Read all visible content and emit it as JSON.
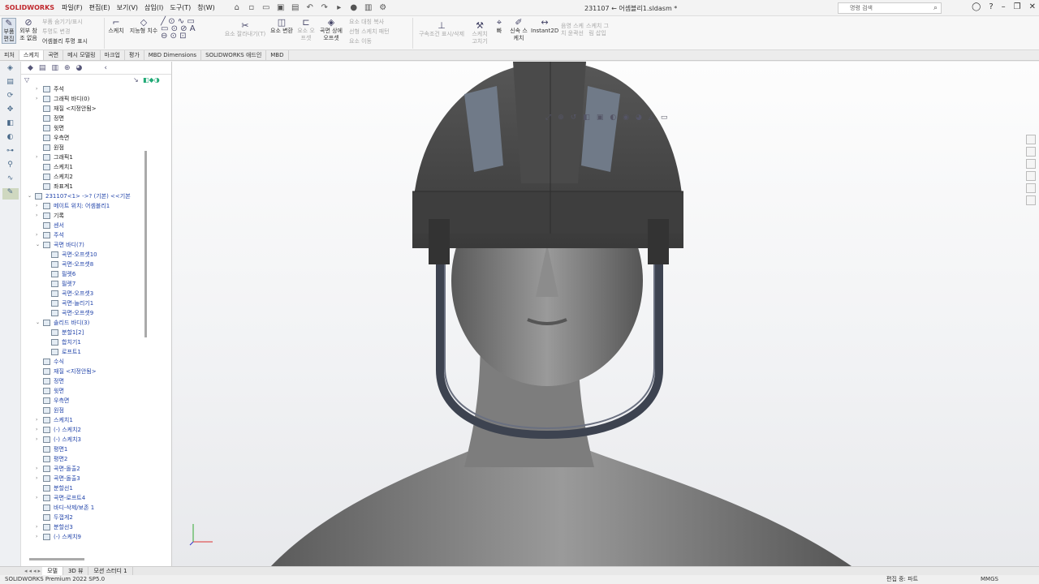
{
  "app": {
    "logo_text": "SOLIDWORKS",
    "document_title": "231107 ← 어셈블리1.sldasm *",
    "search_placeholder": "명령 검색"
  },
  "menus": [
    "파일(F)",
    "편집(E)",
    "보기(V)",
    "삽입(I)",
    "도구(T)",
    "창(W)"
  ],
  "ribbon": {
    "edit_component": "부품 편집",
    "external_ref": "외부 참조 없음",
    "hidden_show": "부품 숨기기/표시",
    "transparency_change": "투명도 변경",
    "assembly_transparency": "어셈블리 투명 표시",
    "sketch": "스케치",
    "smart_dimension": "지능형 치수",
    "surface_flatten": "요소 잘라내기(T)",
    "convert_entities": "요소 변환",
    "offset_entities": "요소 오프셋",
    "offset_on_surface": "곡면 상에 오프셋",
    "mirror_entities": "요소 대칭 복사",
    "linear_pattern": "선형 스케치 패턴",
    "move_entities": "요소 이동",
    "show_relations": "구속조건 표시/삭제",
    "repair_sketch": "스케치 고치기",
    "quick_snaps": "빠",
    "rapid_sketch": "신속 스케치",
    "instant2d": "Instant2D",
    "shaded_sketch": "음영 스케치 윤곽선",
    "sketch_picture": "스케치 그림 삽입"
  },
  "command_tabs": [
    "피처",
    "스케치",
    "곡면",
    "메시 모델링",
    "마크업",
    "평가",
    "MBD Dimensions",
    "SOLIDWORKS 애드인",
    "MBD"
  ],
  "active_command_tab": "스케치",
  "tree": [
    {
      "label": "주석",
      "level": 1,
      "expand": "›",
      "blue": false
    },
    {
      "label": "그래픽 바디(0)",
      "level": 1,
      "expand": "›",
      "blue": false
    },
    {
      "label": "재질 <지정안됨>",
      "level": 1,
      "expand": "",
      "blue": false
    },
    {
      "label": "정면",
      "level": 1,
      "expand": "",
      "blue": false
    },
    {
      "label": "윗면",
      "level": 1,
      "expand": "",
      "blue": false
    },
    {
      "label": "우측면",
      "level": 1,
      "expand": "",
      "blue": false
    },
    {
      "label": "원점",
      "level": 1,
      "expand": "",
      "blue": false
    },
    {
      "label": "그래픽1",
      "level": 1,
      "expand": "›",
      "blue": false
    },
    {
      "label": "스케치1",
      "level": 1,
      "expand": "",
      "blue": false
    },
    {
      "label": "스케치2",
      "level": 1,
      "expand": "",
      "blue": false
    },
    {
      "label": "좌표계1",
      "level": 1,
      "expand": "",
      "blue": false
    },
    {
      "label": "231107<1> ->? (기본) <<기본",
      "level": 0,
      "expand": "⌄",
      "blue": true
    },
    {
      "label": "메이트 위치: 어셈블리1",
      "level": 1,
      "expand": "›",
      "blue": true
    },
    {
      "label": "기록",
      "level": 1,
      "expand": "›",
      "blue": false
    },
    {
      "label": "센서",
      "level": 1,
      "expand": "",
      "blue": true
    },
    {
      "label": "주석",
      "level": 1,
      "expand": "›",
      "blue": true
    },
    {
      "label": "곡면 바디(7)",
      "level": 1,
      "expand": "⌄",
      "blue": true
    },
    {
      "label": "곡면-오프셋10",
      "level": 2,
      "expand": "",
      "blue": true
    },
    {
      "label": "곡면-오프셋8",
      "level": 2,
      "expand": "",
      "blue": true
    },
    {
      "label": "필렛6",
      "level": 2,
      "expand": "",
      "blue": true
    },
    {
      "label": "필렛7",
      "level": 2,
      "expand": "",
      "blue": true
    },
    {
      "label": "곡면-오프셋3",
      "level": 2,
      "expand": "",
      "blue": true
    },
    {
      "label": "곡면-늘리기1",
      "level": 2,
      "expand": "",
      "blue": true
    },
    {
      "label": "곡면-오프셋9",
      "level": 2,
      "expand": "",
      "blue": true
    },
    {
      "label": "솔리드 바디(3)",
      "level": 1,
      "expand": "⌄",
      "blue": true
    },
    {
      "label": "분할1[2]",
      "level": 2,
      "expand": "",
      "blue": true
    },
    {
      "label": "합치기1",
      "level": 2,
      "expand": "",
      "blue": true
    },
    {
      "label": "로프트1",
      "level": 2,
      "expand": "",
      "blue": true
    },
    {
      "label": "수식",
      "level": 1,
      "expand": "",
      "blue": true
    },
    {
      "label": "재질 <지정안됨>",
      "level": 1,
      "expand": "",
      "blue": true
    },
    {
      "label": "정면",
      "level": 1,
      "expand": "",
      "blue": true
    },
    {
      "label": "윗면",
      "level": 1,
      "expand": "",
      "blue": true
    },
    {
      "label": "우측면",
      "level": 1,
      "expand": "",
      "blue": true
    },
    {
      "label": "원점",
      "level": 1,
      "expand": "",
      "blue": true
    },
    {
      "label": "스케치1",
      "level": 1,
      "expand": "›",
      "blue": true
    },
    {
      "label": "(-) 스케치2",
      "level": 1,
      "expand": "›",
      "blue": true
    },
    {
      "label": "(-) 스케치3",
      "level": 1,
      "expand": "›",
      "blue": true
    },
    {
      "label": "평면1",
      "level": 1,
      "expand": "",
      "blue": true
    },
    {
      "label": "평면2",
      "level": 1,
      "expand": "",
      "blue": true
    },
    {
      "label": "곡면-돌출2",
      "level": 1,
      "expand": "›",
      "blue": true
    },
    {
      "label": "곡면-돌출3",
      "level": 1,
      "expand": "›",
      "blue": true
    },
    {
      "label": "분할선1",
      "level": 1,
      "expand": "",
      "blue": true
    },
    {
      "label": "곡면-로프트4",
      "level": 1,
      "expand": "›",
      "blue": true
    },
    {
      "label": "바디-삭제/보존 1",
      "level": 1,
      "expand": "",
      "blue": true
    },
    {
      "label": "두껍게2",
      "level": 1,
      "expand": "",
      "blue": true
    },
    {
      "label": "분할선3",
      "level": 1,
      "expand": "›",
      "blue": true
    },
    {
      "label": "(-) 스케치9",
      "level": 1,
      "expand": "›",
      "blue": true
    }
  ],
  "bottom_tabs": [
    "모델",
    "3D 뷰",
    "모션 스터디 1"
  ],
  "active_bottom_tab": "모델",
  "status": {
    "product": "SOLIDWORKS Premium 2022 SP5.0",
    "editing": "편집 중: 파트",
    "units": "MMGS"
  },
  "colors": {
    "brand_red": "#c0282d",
    "helmet": "#4a4a4a",
    "visor_frame": "#3d4350",
    "mannequin": "#8a8a8a"
  }
}
